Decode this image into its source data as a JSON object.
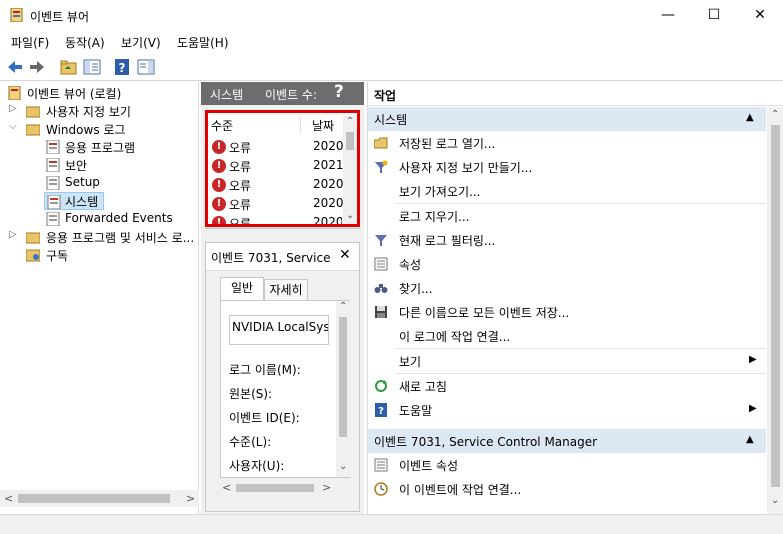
{
  "window": {
    "title": "이벤트 뷰어",
    "minimize": "—",
    "maximize": "☐",
    "close": "✕"
  },
  "menu": [
    "파일(F)",
    "동작(A)",
    "보기(V)",
    "도움말(H)"
  ],
  "tree": {
    "root": "이벤트 뷰어 (로컬)",
    "custom_views": "사용자 지정 보기",
    "windows_logs": "Windows 로그",
    "app": "응용 프로그램",
    "security": "보안",
    "setup": "Setup",
    "system": "시스템",
    "forwarded": "Forwarded Events",
    "app_services": "응용 프로그램 및 서비스 로...",
    "subscriptions": "구독"
  },
  "middle": {
    "header_title": "시스템",
    "header_count": "이벤트 수:",
    "col_level": "수준",
    "col_date": "날짜",
    "rows": [
      {
        "level": "오류",
        "date": "2020"
      },
      {
        "level": "오류",
        "date": "2021"
      },
      {
        "level": "오류",
        "date": "2020"
      },
      {
        "level": "오류",
        "date": "2020"
      },
      {
        "level": "오류",
        "date": "2020"
      }
    ],
    "detail_title": "이벤트 7031, Service",
    "tab_general": "일반",
    "tab_details": "자세히",
    "desc_text": "NVIDIA LocalSyste",
    "field_log": "로그 이름(M):",
    "field_source": "원본(S):",
    "field_eventid": "이벤트 ID(E):",
    "field_level": "수준(L):",
    "field_user": "사용자(U):"
  },
  "right": {
    "header": "작업",
    "section1": "시스템",
    "actions1": [
      "저장된 로그 열기...",
      "사용자 지정 보기 만들기...",
      "보기 가져오기...",
      "로그 지우기...",
      "현재 로그 필터링...",
      "속성",
      "찾기...",
      "다른 이름으로 모든 이벤트 저장...",
      "이 로그에 작업 연결...",
      "보기",
      "새로 고침",
      "도움말"
    ],
    "section2": "이벤트 7031, Service Control Manager",
    "actions2": [
      "이벤트 속성",
      "이 이벤트에 작업 연결..."
    ]
  }
}
